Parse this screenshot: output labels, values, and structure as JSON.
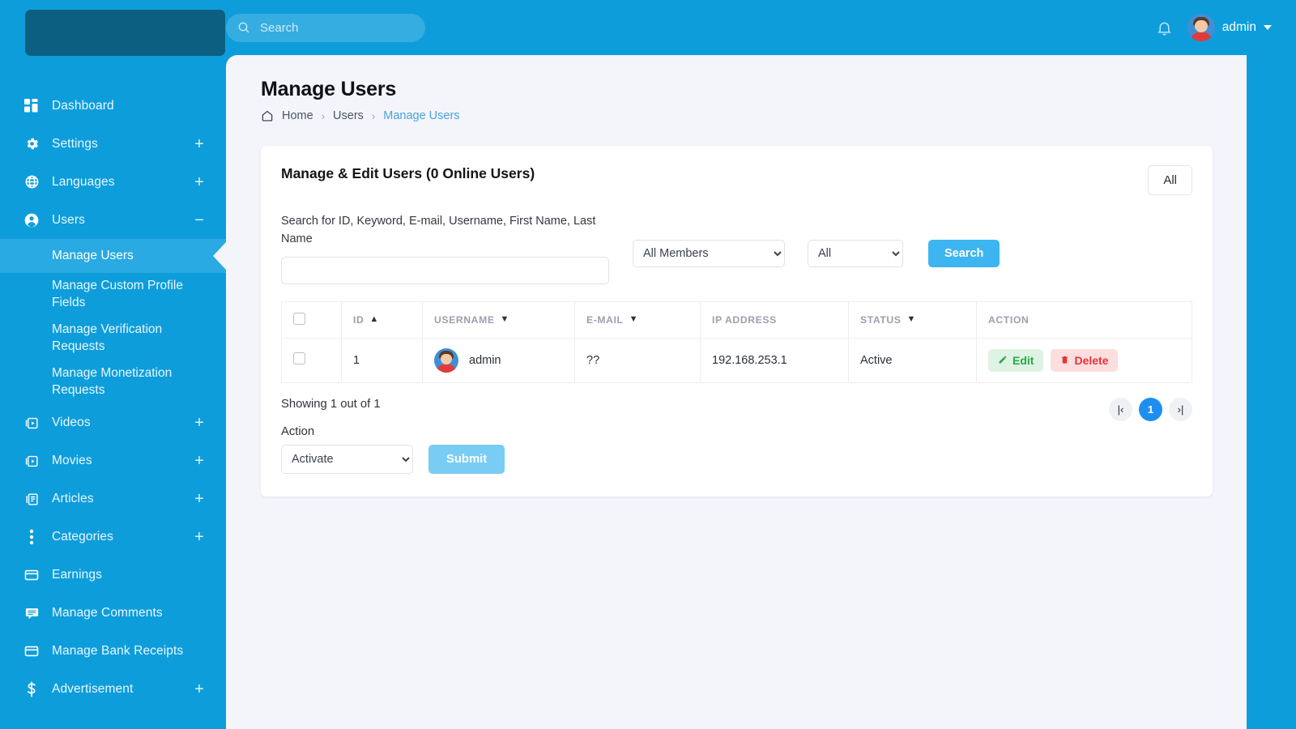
{
  "brand": {
    "accent": "#0d9ddb",
    "active_item": "#29aae2",
    "link": "#49a2dd",
    "logo_alt": ""
  },
  "topbar": {
    "search_placeholder": "Search",
    "search_value": "",
    "search_icon": "search-icon",
    "bell_icon": "bell-icon",
    "username": "admin",
    "caret_icon": "chevron-down-icon"
  },
  "sidebar": {
    "items": [
      {
        "label": "Dashboard",
        "icon": "dashboard-grid-icon",
        "expand": ""
      },
      {
        "label": "Settings",
        "icon": "gear-icon",
        "expand": "+"
      },
      {
        "label": "Languages",
        "icon": "globe-icon",
        "expand": "+"
      },
      {
        "label": "Users",
        "icon": "user-circle-icon",
        "expand": "−"
      },
      {
        "label": "Videos",
        "icon": "video-stack-icon",
        "expand": "+"
      },
      {
        "label": "Movies",
        "icon": "video-stack-icon",
        "expand": "+"
      },
      {
        "label": "Articles",
        "icon": "articles-icon",
        "expand": "+"
      },
      {
        "label": "Categories",
        "icon": "dots-vertical-icon",
        "expand": "+"
      },
      {
        "label": "Earnings",
        "icon": "card-icon",
        "expand": ""
      },
      {
        "label": "Manage Comments",
        "icon": "comment-icon",
        "expand": ""
      },
      {
        "label": "Manage Bank Receipts",
        "icon": "card-icon",
        "expand": ""
      },
      {
        "label": "Advertisement",
        "icon": "dollar-icon",
        "expand": "+"
      }
    ],
    "users_submenu": [
      {
        "label": "Manage Users",
        "active": true
      },
      {
        "label": "Manage Custom Profile Fields",
        "active": false
      },
      {
        "label": "Manage Verification Requests",
        "active": false
      },
      {
        "label": "Manage Monetization Requests",
        "active": false
      }
    ]
  },
  "page": {
    "title": "Manage Users",
    "breadcrumb": {
      "home_icon": "home-icon",
      "home": "Home",
      "sep": "›",
      "parent": "Users",
      "current": "Manage Users"
    }
  },
  "card": {
    "title": "Manage & Edit Users (0 Online Users)",
    "all_button": "All",
    "search_label": "Search for ID, Keyword, E-mail, Username, First Name, Last Name",
    "search_value": "",
    "members_select": "All Members",
    "type_select": "All",
    "search_button": "Search"
  },
  "table": {
    "columns": [
      {
        "key": "checkbox",
        "label": "",
        "sort": ""
      },
      {
        "key": "id",
        "label": "ID",
        "sort": "▲"
      },
      {
        "key": "username",
        "label": "USERNAME",
        "sort": "▼"
      },
      {
        "key": "email",
        "label": "E-MAIL",
        "sort": "▼"
      },
      {
        "key": "ip",
        "label": "IP ADDRESS",
        "sort": ""
      },
      {
        "key": "status",
        "label": "STATUS",
        "sort": "▼"
      },
      {
        "key": "action",
        "label": "ACTION",
        "sort": ""
      }
    ],
    "rows": [
      {
        "id": "1",
        "username": "admin",
        "email": "??",
        "ip": "192.168.253.1",
        "status": "Active",
        "edit_label": "Edit",
        "delete_label": "Delete",
        "edit_icon": "pencil-icon",
        "delete_icon": "trash-icon"
      }
    ]
  },
  "footer": {
    "showing": "Showing 1 out of 1",
    "action_label": "Action",
    "action_select": "Activate",
    "submit_button": "Submit",
    "pagination": {
      "first_icon": "first-page-icon",
      "first_glyph": "|‹",
      "last_icon": "last-page-icon",
      "last_glyph": "›|",
      "current_page": "1"
    }
  }
}
